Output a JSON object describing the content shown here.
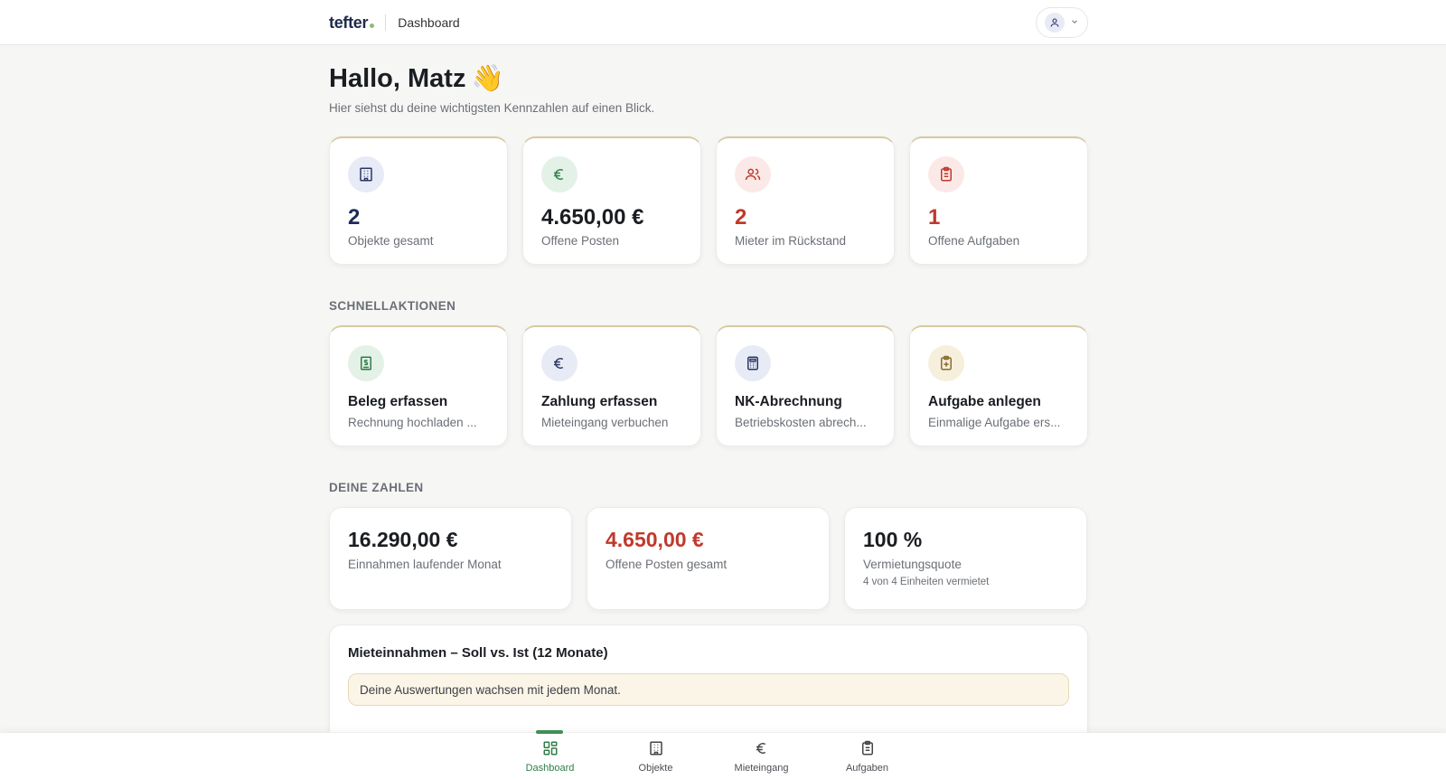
{
  "header": {
    "logo": "tefter",
    "title": "Dashboard"
  },
  "greeting": {
    "title": "Hallo, Matz",
    "emoji": "👋",
    "subtitle": "Hier siehst du deine wichtigsten Kennzahlen auf einen Blick."
  },
  "kpis": [
    {
      "value": "2",
      "label": "Objekte gesamt",
      "icon": "building-icon",
      "value_color": "#1e2a5a",
      "icon_bg": "#e7ebf6"
    },
    {
      "value": "4.650,00 €",
      "label": "Offene Posten",
      "icon": "euro-icon",
      "value_color": "#1a1d21",
      "icon_bg": "#e3f1e6"
    },
    {
      "value": "2",
      "label": "Mieter im Rückstand",
      "icon": "users-icon",
      "value_color": "#c0392b",
      "icon_bg": "#fbe9e7"
    },
    {
      "value": "1",
      "label": "Offene Aufgaben",
      "icon": "clipboard-icon",
      "value_color": "#c0392b",
      "icon_bg": "#fbe9e7"
    }
  ],
  "quick_actions": {
    "title": "SCHNELLAKTIONEN",
    "items": [
      {
        "title": "Beleg erfassen",
        "subtitle": "Rechnung hochladen ...",
        "icon": "receipt-icon",
        "icon_bg": "#e3f1e6"
      },
      {
        "title": "Zahlung erfassen",
        "subtitle": "Mieteingang verbuchen",
        "icon": "euro-icon",
        "icon_bg": "#e7ebf6"
      },
      {
        "title": "NK-Abrechnung",
        "subtitle": "Betriebskosten abrech...",
        "icon": "calculator-icon",
        "icon_bg": "#e7ebf6"
      },
      {
        "title": "Aufgabe anlegen",
        "subtitle": "Einmalige Aufgabe ers...",
        "icon": "clipboard-add-icon",
        "icon_bg": "#f5efdc"
      }
    ]
  },
  "numbers": {
    "title": "DEINE ZAHLEN",
    "items": [
      {
        "value": "16.290,00 €",
        "label": "Einnahmen laufender Monat",
        "note": "",
        "value_color": "#1a1d21"
      },
      {
        "value": "4.650,00 €",
        "label": "Offene Posten gesamt",
        "note": "",
        "value_color": "#c0392b"
      },
      {
        "value": "100 %",
        "label": "Vermietungsquote",
        "note": "4 von 4 Einheiten vermietet",
        "value_color": "#1a1d21"
      }
    ]
  },
  "chart": {
    "title": "Mieteinnahmen – Soll vs. Ist (12 Monate)",
    "note": "Deine Auswertungen wachsen mit jedem Monat."
  },
  "bottom_nav": [
    {
      "label": "Dashboard",
      "icon": "grid-icon",
      "active": true
    },
    {
      "label": "Objekte",
      "icon": "building-icon",
      "active": false
    },
    {
      "label": "Mieteingang",
      "icon": "euro-icon",
      "active": false
    },
    {
      "label": "Aufgaben",
      "icon": "clipboard-icon",
      "active": false
    }
  ],
  "colors": {
    "accent_green": "#2f7d47",
    "danger_red": "#c0392b",
    "navy": "#1e2a5a",
    "card_top_border": "#d8c9a0"
  }
}
